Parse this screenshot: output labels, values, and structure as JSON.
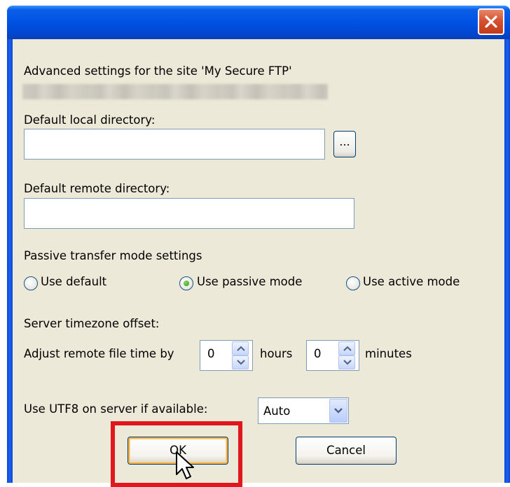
{
  "window": {
    "title": "",
    "close_glyph": "✕"
  },
  "header": {
    "text": "Advanced settings for the site 'My Secure FTP'"
  },
  "local_dir": {
    "label": "Default local directory:",
    "value": "",
    "browse_label": "..."
  },
  "remote_dir": {
    "label": "Default remote directory:",
    "value": ""
  },
  "passive": {
    "label": "Passive transfer mode settings",
    "options": [
      {
        "label": "Use default",
        "selected": false
      },
      {
        "label": "Use passive mode",
        "selected": true
      },
      {
        "label": "Use active mode",
        "selected": false
      }
    ]
  },
  "timezone": {
    "label": "Server timezone offset:",
    "adjust_label": "Adjust remote file time by",
    "hours_value": "0",
    "hours_label": "hours",
    "minutes_value": "0",
    "minutes_label": "minutes"
  },
  "utf8": {
    "label": "Use UTF8 on server if available:",
    "selected": "Auto"
  },
  "buttons": {
    "ok": "OK",
    "cancel": "Cancel"
  },
  "colors": {
    "highlight": "#e0171d",
    "title_bar": "#0054e3",
    "dialog_bg": "#ece9d8"
  },
  "icons": [
    "close-icon",
    "radio-icon",
    "spin-up-icon",
    "spin-down-icon",
    "dropdown-arrow-icon",
    "mouse-cursor-icon"
  ]
}
